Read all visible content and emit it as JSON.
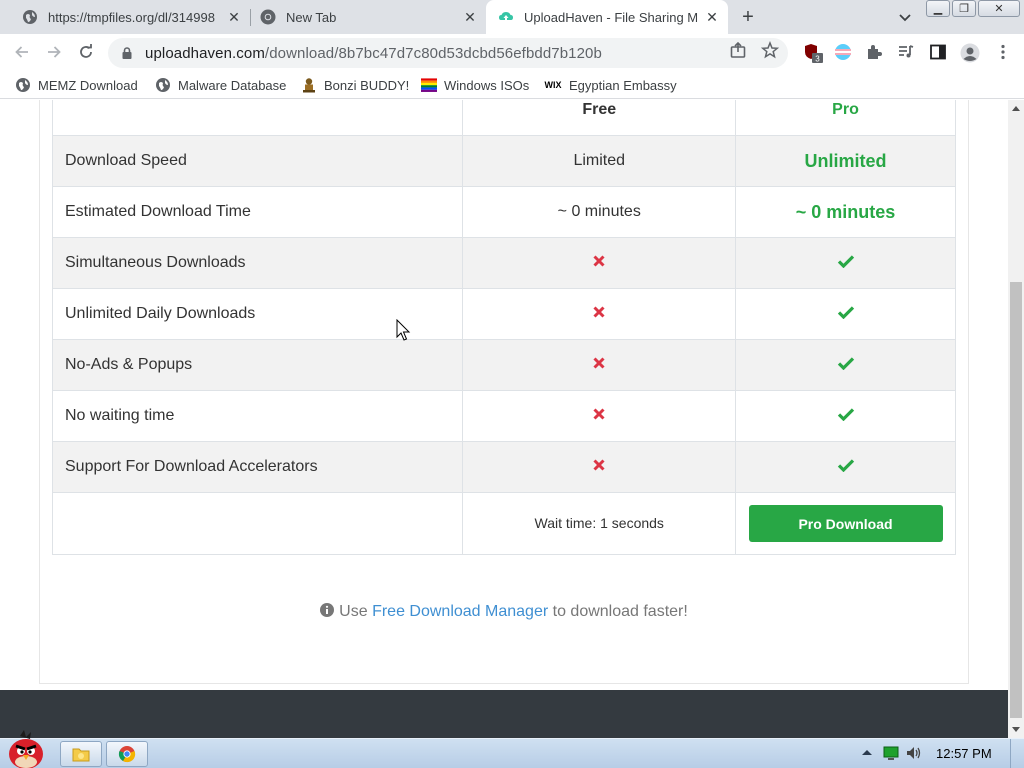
{
  "browser": {
    "tabs": [
      {
        "title": "https://tmpfiles.org/dl/314998",
        "active": false
      },
      {
        "title": "New Tab",
        "active": false
      },
      {
        "title": "UploadHaven - File Sharing M",
        "active": true
      }
    ],
    "url_domain": "uploadhaven.com",
    "url_path": "/download/8b7bc47d7c80d53dcbd56efbdd7b120b",
    "extension_badge": "3",
    "window_buttons": {
      "minimize": "▁",
      "restore": "❐",
      "close": "✕"
    }
  },
  "bookmarks": [
    {
      "label": "MEMZ Download",
      "icon": "globe-icon"
    },
    {
      "label": "Malware Database",
      "icon": "globe-icon"
    },
    {
      "label": "Bonzi BUDDY!",
      "icon": "bonzi-icon"
    },
    {
      "label": "Windows ISOs",
      "icon": "rainbow-flag-icon"
    },
    {
      "label": "Egyptian Embassy",
      "icon": "wix-icon"
    }
  ],
  "wix_text": "WIX",
  "comparison": {
    "header": {
      "free": "Free",
      "pro": "Pro"
    },
    "rows": [
      {
        "feature": "Download Speed",
        "free": "Limited",
        "pro": "Unlimited"
      },
      {
        "feature": "Estimated Download Time",
        "free": "~ 0 minutes",
        "pro": "~ 0 minutes"
      },
      {
        "feature": "Simultaneous Downloads",
        "free": "cross",
        "pro": "check"
      },
      {
        "feature": "Unlimited Daily Downloads",
        "free": "cross",
        "pro": "check"
      },
      {
        "feature": "No-Ads & Popups",
        "free": "cross",
        "pro": "check"
      },
      {
        "feature": "No waiting time",
        "free": "cross",
        "pro": "check"
      },
      {
        "feature": "Support For Download Accelerators",
        "free": "cross",
        "pro": "check"
      }
    ],
    "wait_text": "Wait time: 1 seconds",
    "pro_button": "Pro Download"
  },
  "fdm": {
    "prefix": "Use",
    "link": "Free Download Manager",
    "suffix": "to download faster!"
  },
  "taskbar": {
    "clock": "12:57 PM"
  },
  "colors": {
    "pro_green": "#28a745",
    "cross_red": "#dc3545",
    "link_blue": "#3f8fd2",
    "footer_dark": "#343a40"
  }
}
